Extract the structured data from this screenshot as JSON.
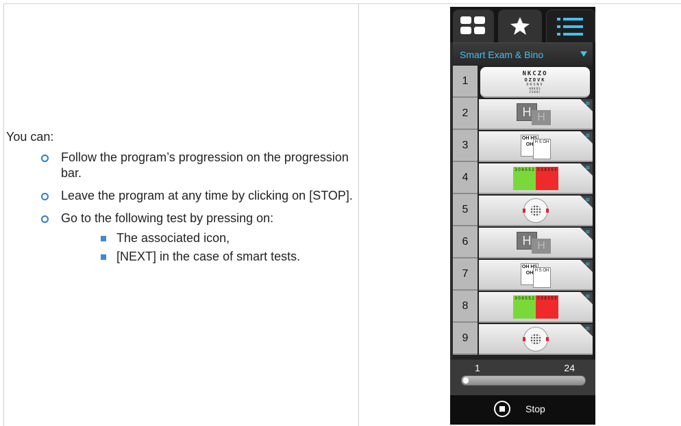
{
  "doc": {
    "intro": "You can:",
    "items": [
      "Follow the program’s progression on the progression bar.",
      "Leave the program at any time by clicking on [STOP].",
      "Go to the following test by pressing on:"
    ],
    "subitems": [
      "The associated icon,",
      "[NEXT] in the case of smart tests."
    ]
  },
  "panel": {
    "tabs": [
      {
        "icon": "grid-icon",
        "active": false
      },
      {
        "icon": "star-icon",
        "active": false
      },
      {
        "icon": "list-icon",
        "active": true
      }
    ],
    "dropdown": {
      "value": "Smart Exam & Bino"
    },
    "colors": {
      "accent": "#3fc2f0",
      "green": "#7ad93a",
      "red": "#ef2a2a"
    },
    "tests": [
      {
        "num": "1",
        "type": "snellen-chart",
        "lines": [
          "NKCZO",
          "OZDVK",
          "DKSNV",
          "HRKDS",
          "ZSNOC"
        ]
      },
      {
        "num": "2",
        "type": "h-cross",
        "text": "H"
      },
      {
        "num": "3",
        "type": "letter-chart",
        "a": "OH HS OH",
        "b": "H S OH"
      },
      {
        "num": "4",
        "type": "red-green",
        "g": "3 0 8 5 5 2",
        "r": "0 3 8 3 5 5"
      },
      {
        "num": "5",
        "type": "dot-disc"
      },
      {
        "num": "6",
        "type": "h-cross",
        "text": "H"
      },
      {
        "num": "7",
        "type": "letter-chart",
        "a": "OH HS OH",
        "b": "H S OH"
      },
      {
        "num": "8",
        "type": "red-green",
        "g": "3 0 8 5 5 2",
        "r": "0 3 8 3 5 5"
      },
      {
        "num": "9",
        "type": "dot-disc"
      }
    ],
    "progress": {
      "start": "1",
      "end": "24",
      "fraction": 0.03
    },
    "stop_label": "Stop"
  }
}
